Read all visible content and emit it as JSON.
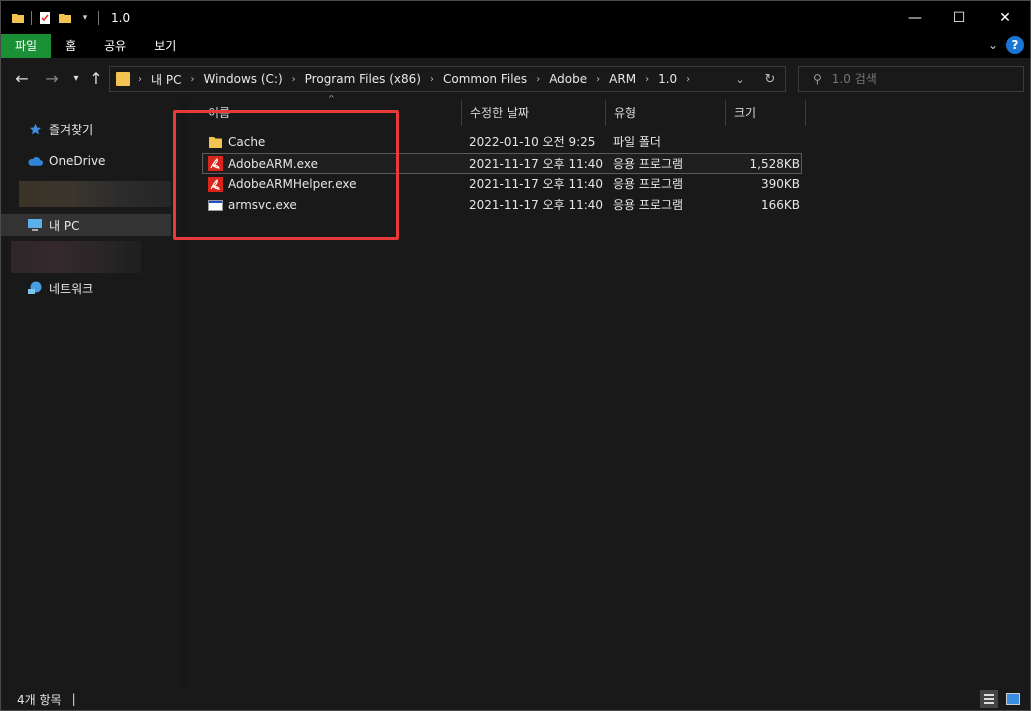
{
  "window": {
    "title": "1.0"
  },
  "ribbon": {
    "tabs": [
      "파일",
      "홈",
      "공유",
      "보기"
    ],
    "active_color": "#1a8f36"
  },
  "address": {
    "crumbs": [
      "내 PC",
      "Windows (C:)",
      "Program Files (x86)",
      "Common Files",
      "Adobe",
      "ARM",
      "1.0"
    ]
  },
  "search": {
    "placeholder": "1.0 검색"
  },
  "sidebar": {
    "items": [
      {
        "label": "즐겨찾기",
        "icon": "star-icon"
      },
      {
        "label": "OneDrive",
        "icon": "cloud-icon"
      },
      {
        "label": "내 PC",
        "icon": "computer-icon",
        "selected": true
      },
      {
        "label": "네트워크",
        "icon": "network-icon"
      }
    ]
  },
  "columns": [
    "이름",
    "수정한 날짜",
    "유형",
    "크기"
  ],
  "files": [
    {
      "name": "Cache",
      "date": "2022-01-10 오전 9:25",
      "type": "파일 폴더",
      "size": "",
      "icon": "folder-icon"
    },
    {
      "name": "AdobeARM.exe",
      "date": "2021-11-17 오후 11:40",
      "type": "응용 프로그램",
      "size": "1,528KB",
      "icon": "adobe-icon"
    },
    {
      "name": "AdobeARMHelper.exe",
      "date": "2021-11-17 오후 11:40",
      "type": "응용 프로그램",
      "size": "390KB",
      "icon": "adobe-icon"
    },
    {
      "name": "armsvc.exe",
      "date": "2021-11-17 오후 11:40",
      "type": "응용 프로그램",
      "size": "166KB",
      "icon": "app-window-icon"
    }
  ],
  "status": {
    "count": "4개 항목"
  },
  "colors": {
    "highlight": "#e8393b",
    "folder": "#f2c350",
    "adobe_red": "#d9261c"
  }
}
